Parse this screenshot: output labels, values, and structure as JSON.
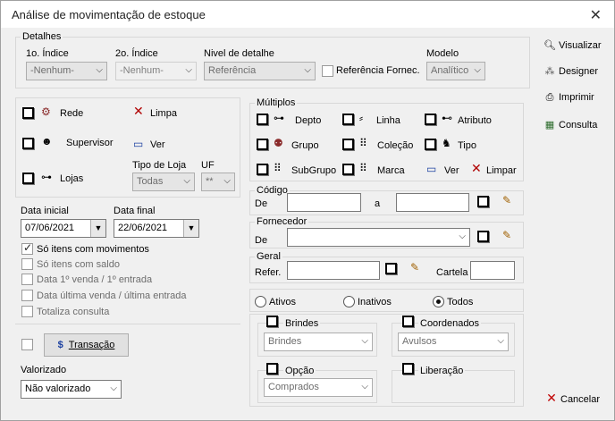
{
  "window": {
    "title": "Análise de movimentação de estoque",
    "close_glyph": "✕"
  },
  "detalhes": {
    "legend": "Detalhes",
    "indice1": {
      "label": "1o. Índice",
      "value": "-Nenhum-"
    },
    "indice2": {
      "label": "2o. Índice",
      "value": "-Nenhum-"
    },
    "nivel": {
      "label": "Nivel de detalhe",
      "value": "Referência"
    },
    "ref_fornec": {
      "label": "Referência Fornec.",
      "checked": false
    },
    "modelo": {
      "label": "Modelo",
      "value": "Analítico"
    }
  },
  "grupo_loja": {
    "rede": "Rede",
    "limpa": "Limpa",
    "supervisor": "Supervisor",
    "ver": "Ver",
    "lojas": "Lojas",
    "tipo_loja": {
      "label": "Tipo de Loja",
      "value": "Todas"
    },
    "uf": {
      "label": "UF",
      "value": "**"
    }
  },
  "datas": {
    "inicial": {
      "label": "Data inicial",
      "value": "07/06/2021"
    },
    "final": {
      "label": "Data final",
      "value": "22/06/2021"
    }
  },
  "opcoes": [
    {
      "label": "Só itens com movimentos",
      "checked": true
    },
    {
      "label": "Só itens com saldo",
      "checked": false
    },
    {
      "label": "Data 1º venda / 1º entrada",
      "checked": false
    },
    {
      "label": "Data última venda / última entrada",
      "checked": false
    },
    {
      "label": "Totaliza consulta",
      "checked": false
    }
  ],
  "transacao": {
    "label": "Transação",
    "icon_glyph": "$"
  },
  "valorizado": {
    "label": "Valorizado",
    "value": "Não valorizado"
  },
  "multiplos": {
    "legend": "Múltiplos",
    "items": [
      "Depto",
      "Linha",
      "Atributo",
      "Grupo",
      "Coleção",
      "Tipo",
      "SubGrupo",
      "Marca"
    ],
    "ver": "Ver",
    "limpar": "Limpar"
  },
  "codigo": {
    "legend": "Código",
    "de": "De",
    "a": "a"
  },
  "fornecedor": {
    "legend": "Fornecedor",
    "de": "De"
  },
  "geral": {
    "legend": "Geral",
    "refer": "Refer.",
    "cartela": "Cartela"
  },
  "status": {
    "ativos": "Ativos",
    "inativos": "Inativos",
    "todos": "Todos",
    "selected": "todos"
  },
  "brindes": {
    "label": "Brindes",
    "value": "Brindes"
  },
  "coordenados": {
    "label": "Coordenados",
    "value": "Avulsos"
  },
  "opcao": {
    "label": "Opção",
    "value": "Comprados"
  },
  "liberacao": {
    "label": "Liberação"
  },
  "sidebar": {
    "visualizar": "Visualizar",
    "designer": "Designer",
    "imprimir": "Imprimir",
    "consulta": "Consulta",
    "cancelar": "Cancelar"
  }
}
